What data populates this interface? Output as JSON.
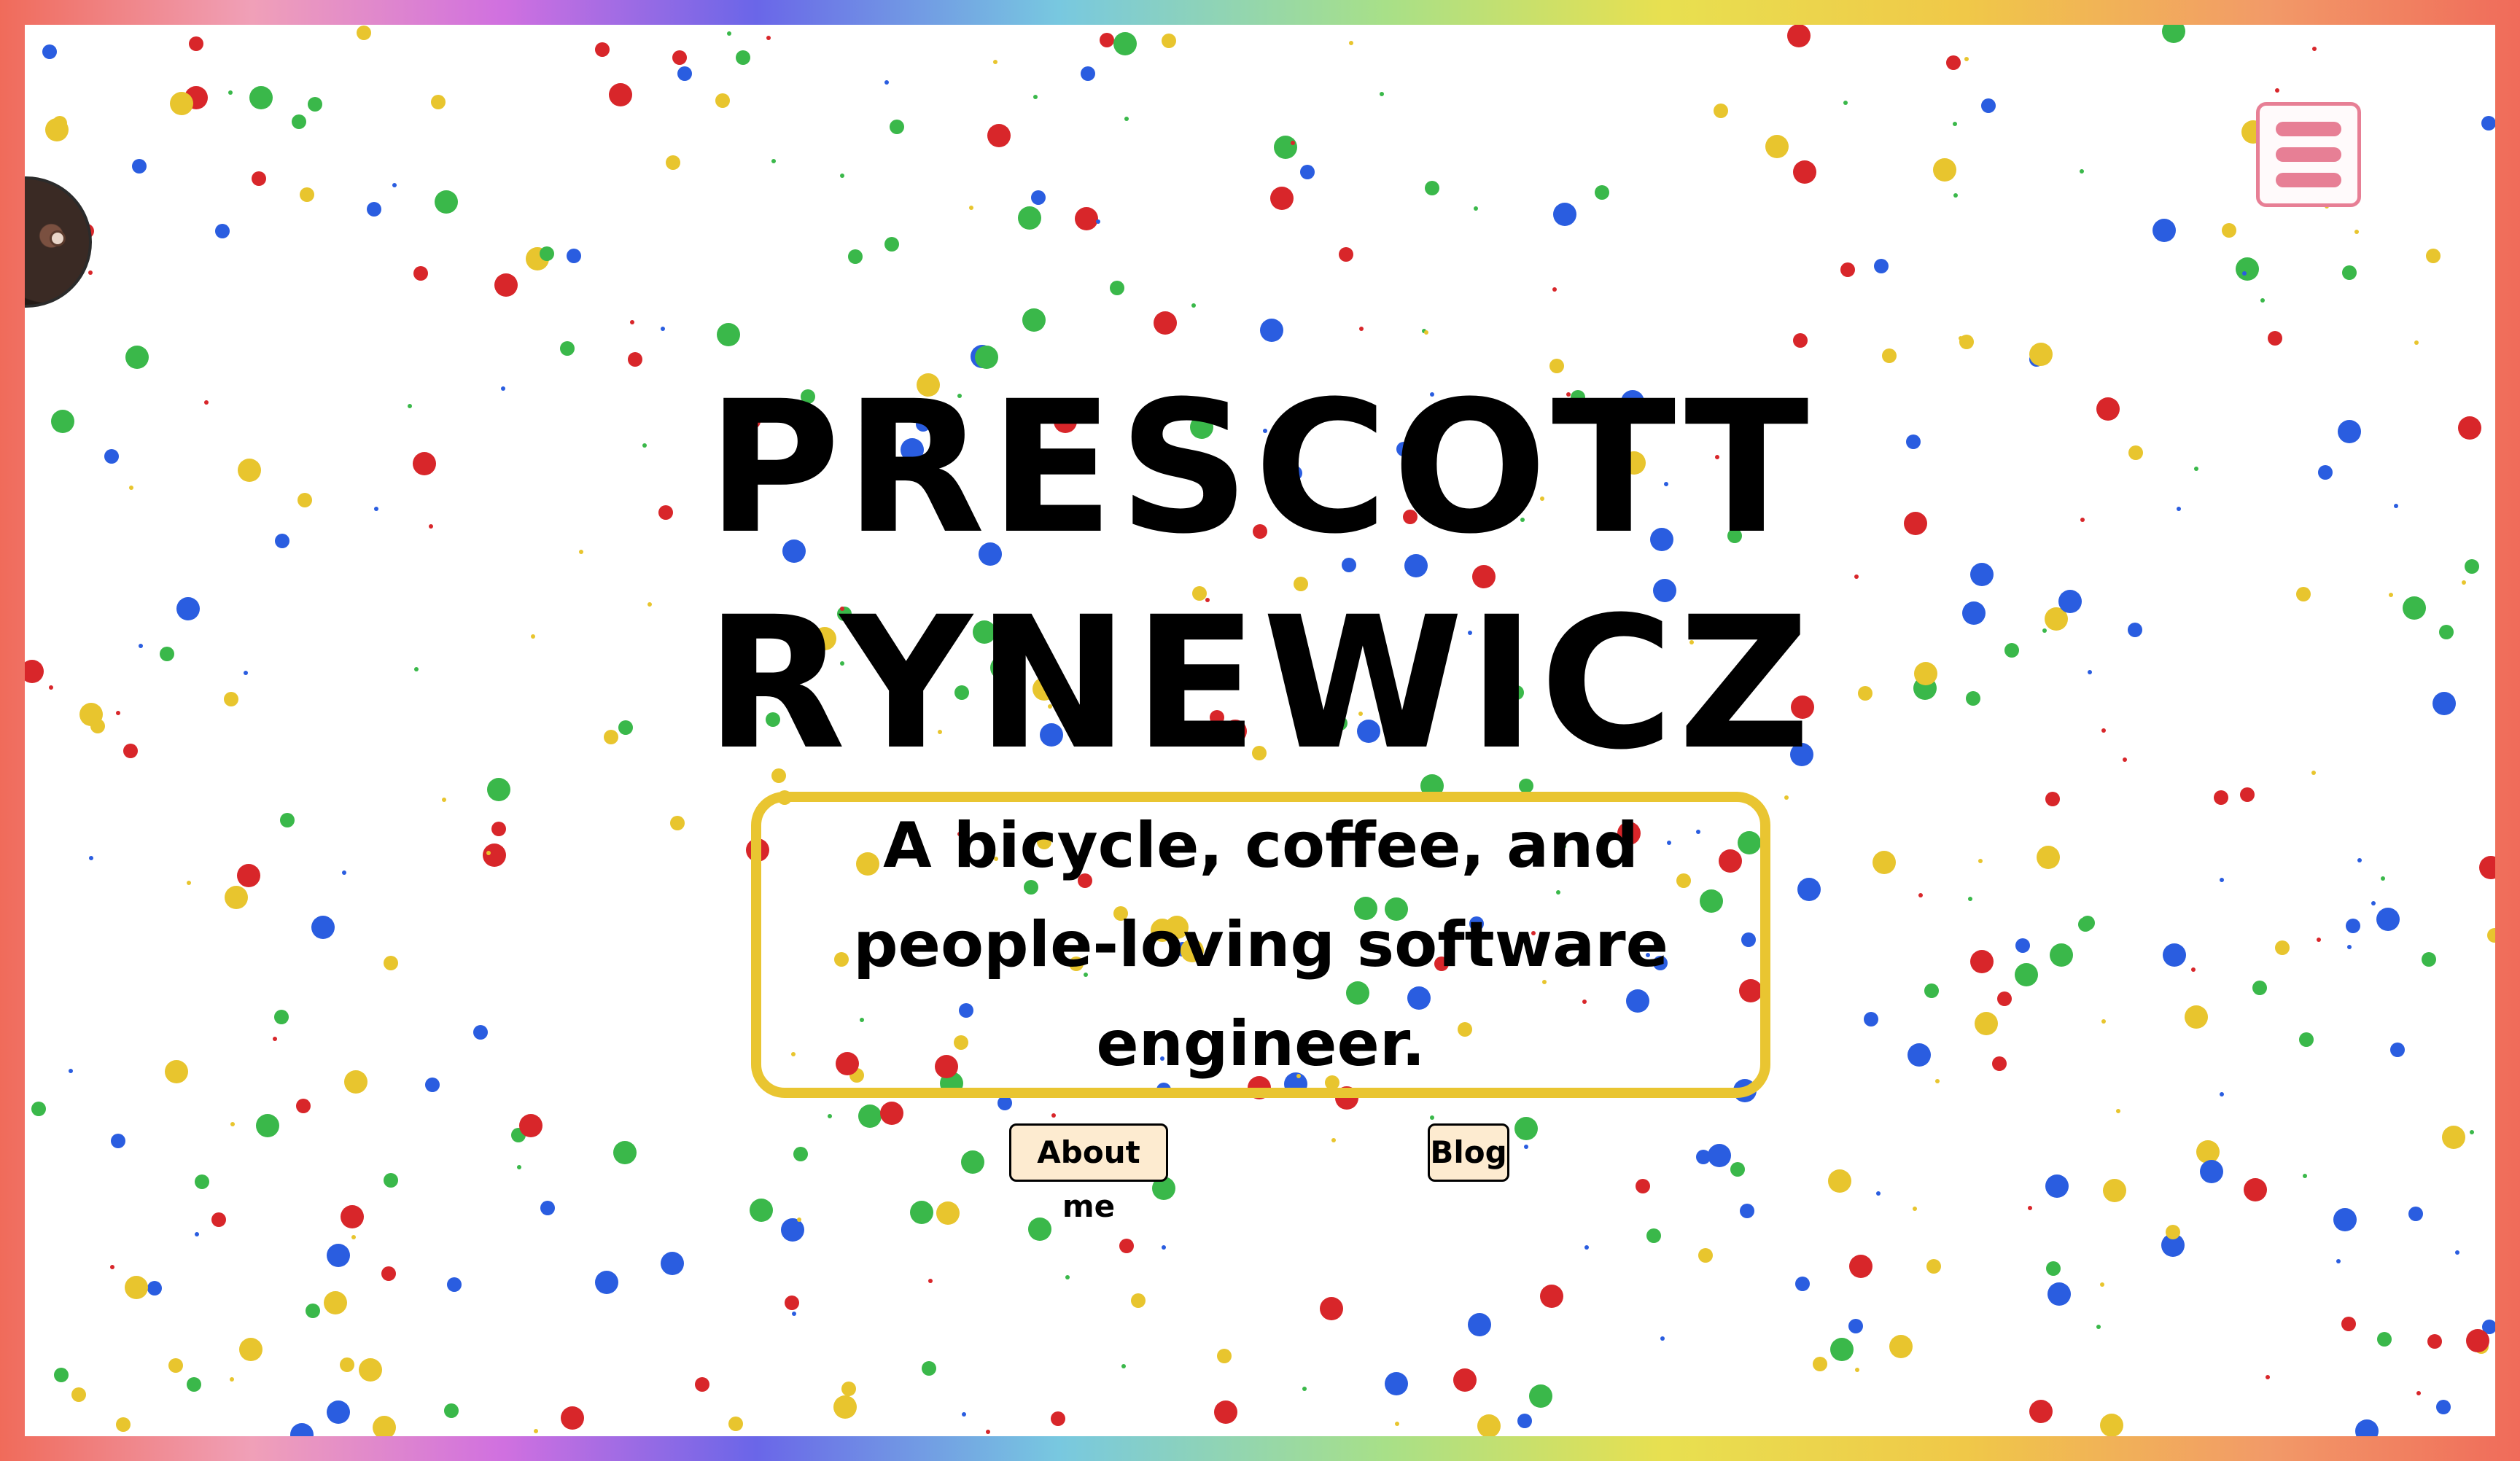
{
  "hero": {
    "title_line1": "PRESCOTT",
    "title_line2": "RYNEWICZ",
    "tagline": "A bicycle, coffee, and people-loving software engineer."
  },
  "nav": {
    "about_label": "About me",
    "blog_label": "Blog"
  },
  "menu": {
    "icon": "hamburger-menu-icon"
  },
  "colors": {
    "accent_yellow": "#e9c531",
    "menu_pink": "#e77f95",
    "button_bg": "#fdebd0",
    "confetti": [
      "#d8262a",
      "#2a5de0",
      "#3ab84a",
      "#e8c52e"
    ]
  }
}
